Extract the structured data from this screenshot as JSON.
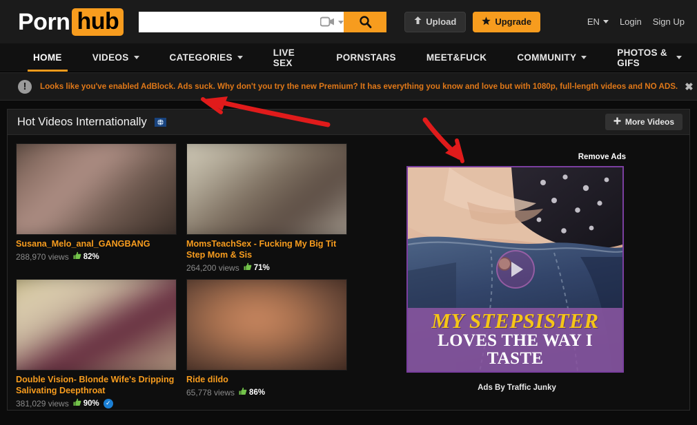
{
  "header": {
    "logo_primary": "Porn",
    "logo_secondary": "hub",
    "search_value": "",
    "search_placeholder": "",
    "search_filter_icon": "video-camera-icon",
    "search_button_icon": "search-icon",
    "upload_label": "Upload",
    "upgrade_label": "Upgrade",
    "language": "EN",
    "login_label": "Login",
    "signup_label": "Sign Up"
  },
  "nav": {
    "items": [
      {
        "label": "HOME",
        "active": true,
        "dropdown": false
      },
      {
        "label": "VIDEOS",
        "active": false,
        "dropdown": true
      },
      {
        "label": "CATEGORIES",
        "active": false,
        "dropdown": true
      },
      {
        "label": "LIVE SEX",
        "active": false,
        "dropdown": false
      },
      {
        "label": "PORNSTARS",
        "active": false,
        "dropdown": false
      },
      {
        "label": "MEET&FUCK",
        "active": false,
        "dropdown": false
      },
      {
        "label": "COMMUNITY",
        "active": false,
        "dropdown": true
      },
      {
        "label": "PHOTOS & GIFS",
        "active": false,
        "dropdown": true
      }
    ]
  },
  "adblock_notice": {
    "icon": "warning-exclamation-icon",
    "message": "Looks like you've enabled AdBlock. Ads suck. Why don't you try the new Premium? It has everything you know and love but with 1080p, full-length videos and NO ADS.",
    "close_label": "✖"
  },
  "section": {
    "title": "Hot Videos Internationally",
    "title_icon": "globe-icon",
    "more_button": "More Videos",
    "more_button_icon": "plus-icon"
  },
  "videos": [
    {
      "title": "Susana_Melo_anal_GANGBANG",
      "views": "288,970 views",
      "rating": "82%",
      "verified": false,
      "thumb_gradient": "linear-gradient(135deg,#3b3129 0%,#8d7166 22%,#b09086 42%,#6f5a50 62%,#4a3b33 82%,#2a2320 100%)"
    },
    {
      "title": "MomsTeachSex - Fucking My Big Tit Step Mom & Sis",
      "views": "264,200 views",
      "rating": "71%",
      "verified": false,
      "thumb_gradient": "linear-gradient(140deg,#ded8c6 0%,#b6ae9c 25%,#7d6f60 48%,#5a4b42 68%,#8e8378 85%,#b9b2a6 100%)"
    },
    {
      "title": "Double Vision- Blonde Wife's Dripping Salivating Deepthroat",
      "views": "381,029 views",
      "rating": "90%",
      "verified": true,
      "thumb_gradient": "linear-gradient(150deg,#a09457 0%,#ded0b0 20%,#c9b79f 38%,#5e2238 58%,#8f6a63 75%,#c3ad8f 100%)"
    },
    {
      "title": "Ride dildo",
      "views": "65,778 views",
      "rating": "86%",
      "verified": false,
      "thumb_gradient": "radial-gradient(ellipse at 45% 45%,#cf8b63 0%,#a9714f 28%,#6d4b3a 55%,#4b3126 78%,#2d1d16 100%)"
    }
  ],
  "ad": {
    "remove_ads_label": "Remove Ads",
    "play_icon": "play-button-icon",
    "caption_line1": "MY STEPSISTER",
    "caption_line2": "LOVES THE WAY I TASTE",
    "credit": "Ads By Traffic Junky"
  },
  "colors": {
    "accent_orange": "#f79c1e",
    "adblock_text": "#e07818",
    "verified_blue": "#1b7fd4",
    "ad_border_purple": "#7b3fa0",
    "annotation_red": "#e01b1b"
  },
  "annotations": [
    {
      "name": "arrow-to-adblock-bar",
      "color": "#e01b1b"
    },
    {
      "name": "arrow-to-ad-banner",
      "color": "#e01b1b"
    }
  ]
}
